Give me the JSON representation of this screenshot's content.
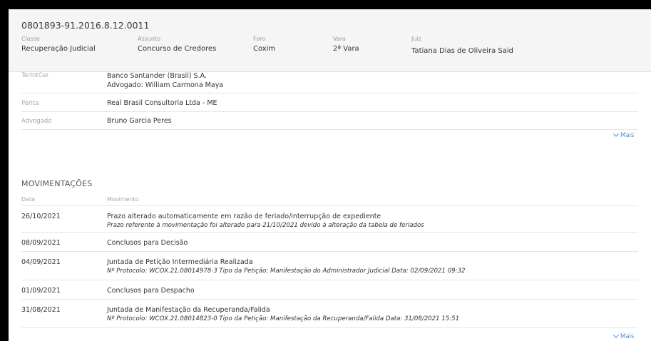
{
  "header": {
    "process_number": "0801893-91.2016.8.12.0011",
    "fields": {
      "classe": {
        "label": "Classe",
        "value": "Recuperação Judicial"
      },
      "assunto": {
        "label": "Assunto",
        "value": "Concurso de Credores"
      },
      "foro": {
        "label": "Foro",
        "value": "Coxim"
      },
      "vara": {
        "label": "Vara",
        "value": "2ª Vara"
      },
      "juiz": {
        "label": "Juiz",
        "value": "Tatiana Dias de Oliveira Said"
      }
    }
  },
  "parties": [
    {
      "label": "TerIntCer",
      "lines": [
        "Banco Santander (Brasil) S.A.",
        "Advogado:  William Carmona Maya"
      ]
    },
    {
      "label": "Perita",
      "lines": [
        "Real Brasil Consultoria Ltda - ME"
      ]
    },
    {
      "label": "Advogado",
      "lines": [
        "Bruno Garcia Peres"
      ]
    }
  ],
  "mais_label": "Mais",
  "movements": {
    "title": "MOVIMENTAÇÕES",
    "col_date": "Data",
    "col_movement": "Movimento",
    "rows": [
      {
        "date": "26/10/2021",
        "text": "Prazo alterado automaticamente em razão de feriado/interrupção de expediente",
        "detail": "Prazo referente à movimentação foi alterado para 21/10/2021 devido à alteração da tabela de feriados"
      },
      {
        "date": "08/09/2021",
        "text": "Conclusos para Decisão",
        "detail": ""
      },
      {
        "date": "04/09/2021",
        "text": "Juntada de Petição Intermediária Realizada",
        "detail": "Nº Protocolo: WCOX.21.08014978-3 Tipo da Petição: Manifestação do Administrador Judicial Data: 02/09/2021 09:32"
      },
      {
        "date": "01/09/2021",
        "text": "Conclusos para Despacho",
        "detail": ""
      },
      {
        "date": "31/08/2021",
        "text": "Juntada de Manifestação da Recuperanda/Falida",
        "detail": "Nº Protocolo: WCOX.21.08014823-0 Tipo da Petição: Manifestação da Recuperanda/Falida Data: 31/08/2021 15:51"
      }
    ]
  },
  "icons": {
    "chevron": "chevron-down-icon"
  },
  "colors": {
    "link": "#4a8fd6",
    "header_bg": "#f5f5f5"
  }
}
